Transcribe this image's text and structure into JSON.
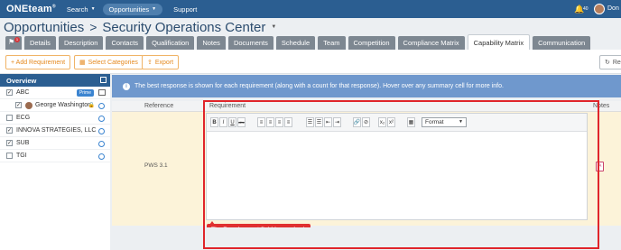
{
  "topnav": {
    "logo": "ONEteam",
    "logo_mark": "®",
    "items": [
      {
        "label": "Search",
        "caret": true
      },
      {
        "label": "Opportunities",
        "caret": true,
        "active": true
      },
      {
        "label": "Support",
        "caret": false
      }
    ],
    "bell_icon": "bell-icon",
    "notification_count": "40",
    "user_name": "Don"
  },
  "page": {
    "title": "Opportunities",
    "separator": ">",
    "subtitle": "Security Operations Center"
  },
  "tabs": {
    "flag_badge": "1",
    "items": [
      "Details",
      "Description",
      "Contacts",
      "Qualification",
      "Notes",
      "Documents",
      "Schedule",
      "Team",
      "Competition",
      "Compliance Matrix",
      "Capability Matrix",
      "Communication"
    ],
    "active": "Capability Matrix"
  },
  "toolbar": {
    "add_requirement": "+ Add Requirement",
    "select_categories": "Select Categories",
    "export": "Export",
    "refresh": "Re"
  },
  "overview": {
    "title": "Overview",
    "orgs": [
      {
        "name": "ABC",
        "checked": true,
        "badge": "Prime"
      },
      {
        "name": "George Washington",
        "checked": true,
        "indent": true,
        "lock": true
      },
      {
        "name": "ECG",
        "checked": false
      },
      {
        "name": "INNOVA STRATEGIES, LLC",
        "checked": true
      },
      {
        "name": "SUB",
        "checked": true
      },
      {
        "name": "TGI",
        "checked": false
      }
    ]
  },
  "banner": {
    "text": "The best response is shown for each requirement (along with a count for that response). Hover over any summary cell for more info."
  },
  "table": {
    "headers": {
      "reference": "Reference",
      "requirement": "Requirement",
      "notes": "Notes"
    },
    "row": {
      "reference": "PWS 3.1"
    }
  },
  "editor": {
    "buttons_format": [
      "B",
      "I",
      "U",
      "abc"
    ],
    "buttons_align": [
      "≡",
      "≡",
      "≡",
      "≡"
    ],
    "buttons_list": [
      "☰",
      "☰",
      "⇤",
      "⇥"
    ],
    "buttons_link": [
      "🔗",
      "⊘"
    ],
    "buttons_script": [
      "x₂",
      "x²"
    ],
    "format_select": "Format"
  },
  "error": {
    "message": "The Requirement field is required."
  },
  "colors": {
    "nav_blue": "#2b5e91",
    "accent_orange": "#e4891f",
    "error_red": "#e03030",
    "row_highlight": "#fcf3d9"
  }
}
